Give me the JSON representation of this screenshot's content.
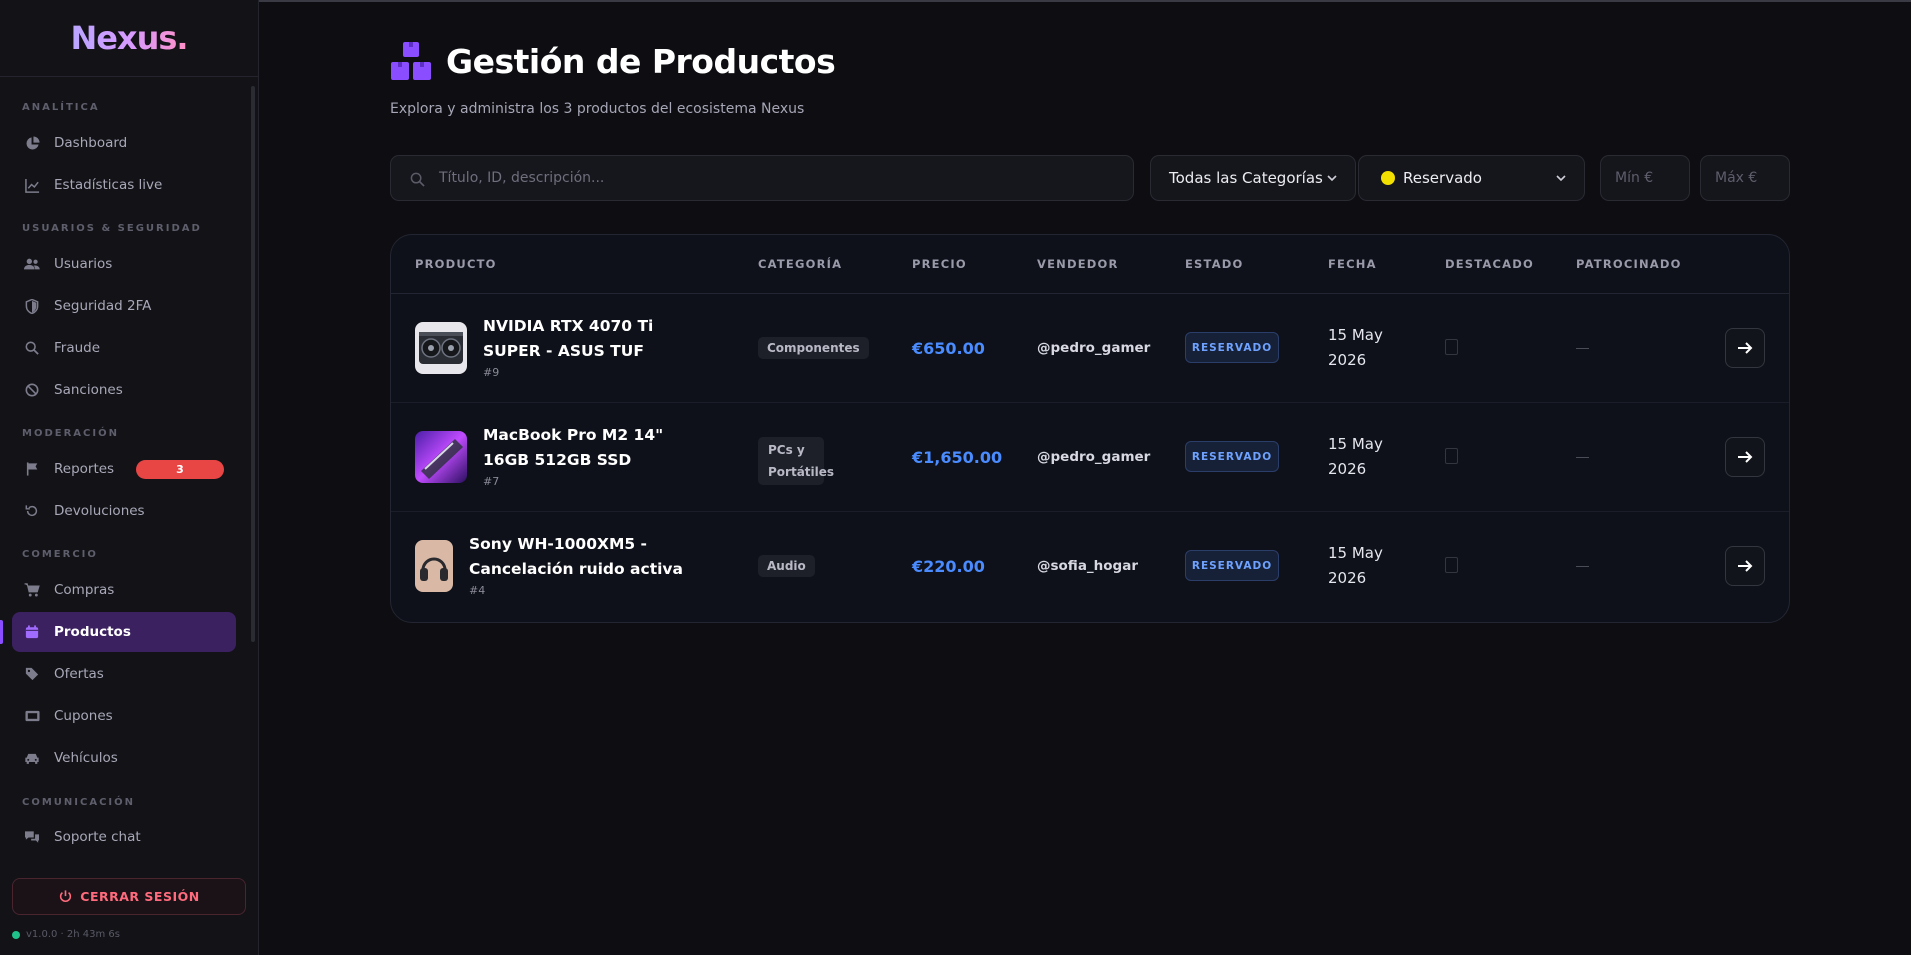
{
  "app": {
    "logo": "Nexus."
  },
  "sidebar": {
    "sections": [
      {
        "label": "ANALÍTICA"
      },
      {
        "label": "USUARIOS & SEGURIDAD"
      },
      {
        "label": "MODERACIÓN"
      },
      {
        "label": "COMERCIO"
      },
      {
        "label": "COMUNICACIÓN"
      }
    ],
    "items": [
      {
        "label": "Dashboard",
        "icon": "pie-chart-icon"
      },
      {
        "label": "Estadísticas live",
        "icon": "line-chart-icon"
      },
      {
        "label": "Usuarios",
        "icon": "users-icon"
      },
      {
        "label": "Seguridad 2FA",
        "icon": "shield-icon"
      },
      {
        "label": "Fraude",
        "icon": "search-icon"
      },
      {
        "label": "Sanciones",
        "icon": "ban-icon"
      },
      {
        "label": "Reportes",
        "icon": "flag-icon",
        "badge": "3"
      },
      {
        "label": "Devoluciones",
        "icon": "undo-icon"
      },
      {
        "label": "Compras",
        "icon": "cart-icon"
      },
      {
        "label": "Productos",
        "icon": "calendar-box-icon",
        "active": true
      },
      {
        "label": "Ofertas",
        "icon": "tag-icon"
      },
      {
        "label": "Cupones",
        "icon": "ticket-icon"
      },
      {
        "label": "Vehículos",
        "icon": "car-icon"
      },
      {
        "label": "Soporte chat",
        "icon": "chat-icon"
      }
    ],
    "logout": "CERRAR SESIÓN",
    "version": "v1.0.0 · 2h 43m 6s"
  },
  "page": {
    "title": "Gestión de Productos",
    "subtitle": "Explora y administra los 3 productos del ecosistema Nexus"
  },
  "filters": {
    "search_placeholder": "Título, ID, descripción...",
    "category": "Todas las Categorías",
    "status": "Reservado",
    "min_placeholder": "Mín €",
    "max_placeholder": "Máx €"
  },
  "table": {
    "headers": [
      "PRODUCTO",
      "CATEGORÍA",
      "PRECIO",
      "VENDEDOR",
      "ESTADO",
      "FECHA",
      "DESTACADO",
      "PATROCINADO"
    ],
    "rows": [
      {
        "name": "NVIDIA RTX 4070 Ti SUPER - ASUS TUF",
        "id": "#9",
        "category": "Componentes",
        "price": "€650.00",
        "seller": "@pedro_gamer",
        "status": "RESERVADO",
        "date": "15 May 2026",
        "sponsored": "—"
      },
      {
        "name": "MacBook Pro M2 14\" 16GB 512GB SSD",
        "id": "#7",
        "category": "PCs y Portátiles",
        "price": "€1,650.00",
        "seller": "@pedro_gamer",
        "status": "RESERVADO",
        "date": "15 May 2026",
        "sponsored": "—"
      },
      {
        "name": "Sony WH-1000XM5 - Cancelación ruido activa",
        "id": "#4",
        "category": "Audio",
        "price": "€220.00",
        "seller": "@sofia_hogar",
        "status": "RESERVADO",
        "date": "15 May 2026",
        "sponsored": "—"
      }
    ]
  },
  "colors": {
    "accent": "#8a4dff",
    "price": "#4a8cff",
    "danger": "#e84545",
    "status_dot": "#f2e000"
  }
}
